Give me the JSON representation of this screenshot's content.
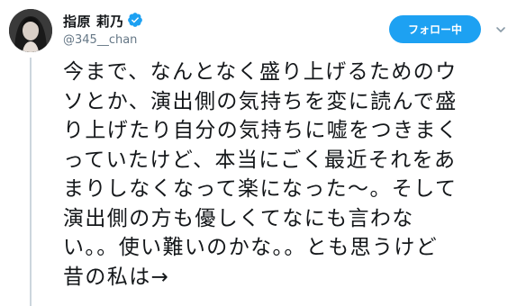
{
  "author": {
    "display_name": "指原 莉乃",
    "handle": "@345__chan",
    "verified": true,
    "avatar_icon": "profile-photo"
  },
  "follow_button": {
    "label": "フォロー中",
    "color": "#1da1f2"
  },
  "menu_icon": "chevron-down-icon",
  "tweet": {
    "lines": [
      "今まで、なんとなく盛り上げるためのウ",
      "ソとか、演出側の気持ちを変に読んで盛",
      "り上げたり自分の気持ちに嘘をつきまく",
      "っていたけど、本当にごく最近それをあ",
      "まりしなくなって楽になった〜。そして",
      "演出側の方も優しくてなにも言わな",
      "い。。使い難いのかな。。とも思うけど",
      "昔の私は→"
    ]
  },
  "colors": {
    "text": "#14171a",
    "secondary": "#657786",
    "thread_line": "#ccd6dd",
    "accent": "#1da1f2"
  }
}
